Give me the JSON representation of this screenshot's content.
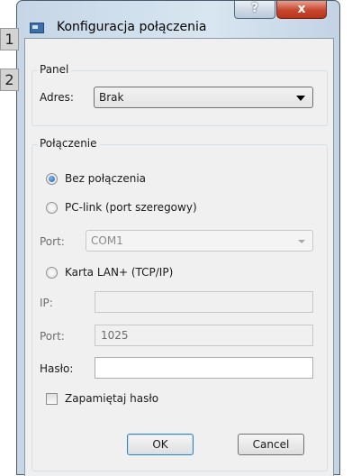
{
  "window": {
    "title": "Konfiguracja połączenia",
    "help_glyph": "?",
    "close_glyph": "x"
  },
  "badges": [
    "1",
    "2"
  ],
  "panel": {
    "legend": "Panel",
    "address_label": "Adres:",
    "address_value": "Brak"
  },
  "connection": {
    "legend": "Połączenie",
    "options": [
      {
        "label": "Bez połączenia",
        "selected": true
      },
      {
        "label": "PC-link (port szeregowy)",
        "selected": false
      },
      {
        "label": "Karta LAN+ (TCP/IP)",
        "selected": false
      }
    ],
    "serial_port_label": "Port:",
    "serial_port_value": "COM1",
    "ip_label": "IP:",
    "ip_value": "",
    "tcp_port_label": "Port:",
    "tcp_port_value": "1025",
    "password_label": "Hasło:",
    "password_value": "",
    "remember_label": "Zapamiętaj hasło",
    "remember_checked": false
  },
  "buttons": {
    "ok": "OK",
    "cancel": "Cancel"
  }
}
